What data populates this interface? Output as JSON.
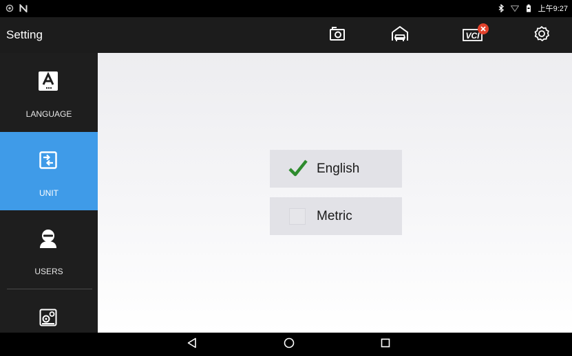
{
  "status_bar": {
    "left_icons": [
      "shield-icon",
      "n-icon"
    ],
    "right_icons": [
      "bluetooth-icon",
      "wifi-icon",
      "battery-icon"
    ],
    "time": "上午9:27"
  },
  "app_bar": {
    "title": "Setting",
    "tools": [
      "camera-icon",
      "garage-icon",
      "vci-icon",
      "settings-gear-icon"
    ],
    "vci_label": "VCI",
    "vci_status_color": "#e2422c"
  },
  "sidebar": {
    "items": [
      {
        "label": "LANGUAGE",
        "icon": "language-icon",
        "active": false
      },
      {
        "label": "UNIT",
        "icon": "unit-switch-icon",
        "active": true
      },
      {
        "label": "USERS",
        "icon": "user-icon",
        "active": false
      },
      {
        "label": "",
        "icon": "system-settings-icon",
        "active": false
      }
    ],
    "active_color": "#3f9be8"
  },
  "unit_options": [
    {
      "label": "English",
      "checked": true
    },
    {
      "label": "Metric",
      "checked": false
    }
  ],
  "nav_bar": {
    "buttons": [
      "back-icon",
      "home-icon",
      "recents-icon"
    ]
  },
  "colors": {
    "check_green": "#2e8b2e",
    "appbar_bg": "#1c1c1c",
    "sidebar_bg": "#1e1e1e"
  }
}
